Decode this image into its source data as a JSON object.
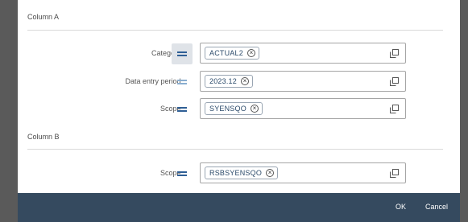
{
  "column_a": {
    "title": "Column A",
    "rows": [
      {
        "label": "Category:",
        "token": "ACTUAL2"
      },
      {
        "label": "Data entry period:",
        "token": "2023.12"
      },
      {
        "label": "Scope:",
        "token": "SYENSQO"
      }
    ]
  },
  "column_b": {
    "title": "Column B",
    "rows": [
      {
        "label": "Scope:",
        "token": "RSBSYENSQO"
      }
    ]
  },
  "footer": {
    "ok_label": "OK",
    "cancel_label": "Cancel"
  },
  "icons": {
    "operator": "equals-icon",
    "remove": "clear-circle-icon",
    "value_help": "value-help-icon"
  },
  "colors": {
    "footer_bg": "#354a5f",
    "operator": "#2f5f95",
    "token_text": "#2b4a6a"
  }
}
